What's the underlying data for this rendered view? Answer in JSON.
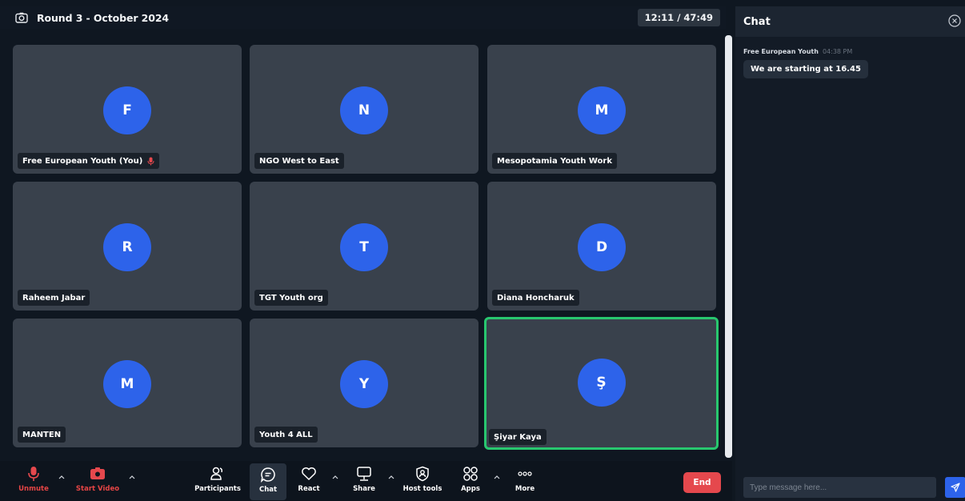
{
  "meeting": {
    "title": "Round 3 - October 2024",
    "timer": "12:11 / 47:49"
  },
  "participants": [
    {
      "initial": "F",
      "name": "Free European Youth (You)",
      "muted": true,
      "active": false
    },
    {
      "initial": "N",
      "name": "NGO West to East",
      "muted": false,
      "active": false
    },
    {
      "initial": "M",
      "name": "Mesopotamia Youth Work",
      "muted": false,
      "active": false
    },
    {
      "initial": "R",
      "name": "Raheem Jabar",
      "muted": false,
      "active": false
    },
    {
      "initial": "T",
      "name": "TGT Youth org",
      "muted": false,
      "active": false
    },
    {
      "initial": "D",
      "name": "Diana Honcharuk",
      "muted": false,
      "active": false
    },
    {
      "initial": "M",
      "name": "MANTEN",
      "muted": false,
      "active": false
    },
    {
      "initial": "Y",
      "name": "Youth 4 ALL",
      "muted": false,
      "active": false
    },
    {
      "initial": "Ş",
      "name": "Şiyar Kaya",
      "muted": false,
      "active": true
    }
  ],
  "toolbar": {
    "unmute": "Unmute",
    "start_video": "Start Video",
    "participants": "Participants",
    "chat": "Chat",
    "react": "React",
    "share": "Share",
    "host_tools": "Host tools",
    "apps": "Apps",
    "more": "More",
    "end": "End"
  },
  "chat": {
    "title": "Chat",
    "messages": [
      {
        "sender": "Free European Youth",
        "time": "04:38 PM",
        "text": "We are starting at 16.45"
      }
    ],
    "input_placeholder": "Type message here..."
  },
  "colors": {
    "avatar": "#2d63ea",
    "tile": "#39414c",
    "active_border": "#28c76f",
    "danger": "#e5484d",
    "background": "#0f1721"
  }
}
